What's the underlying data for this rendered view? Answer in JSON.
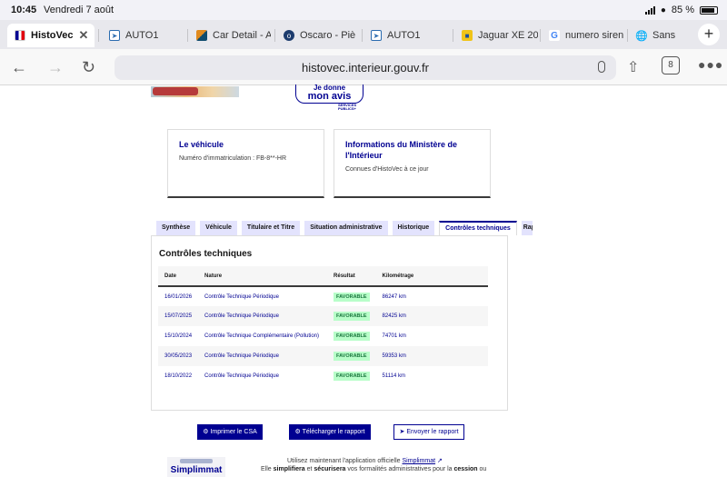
{
  "status_bar": {
    "time": "10:45",
    "date": "Vendredi 7 août",
    "battery": "85 %"
  },
  "tabs": [
    {
      "label": "HistoVec",
      "favicon": "french-flag",
      "active": true
    },
    {
      "label": "AUTO1",
      "favicon": "auto1"
    },
    {
      "label": "Car Detail - A",
      "favicon": "car-detail"
    },
    {
      "label": "Oscaro - Piè",
      "favicon": "oscaro"
    },
    {
      "label": "AUTO1",
      "favicon": "auto1"
    },
    {
      "label": "Jaguar XE 20",
      "favicon": "jaguar"
    },
    {
      "label": "numero siren",
      "favicon": "google"
    },
    {
      "label": "Sans",
      "favicon": "globe"
    }
  ],
  "toolbar": {
    "url": "histovec.interieur.gouv.fr",
    "tab_count": "8"
  },
  "banner": {
    "donne_l1": "Je donne",
    "donne_l2": "mon avis",
    "services_l1": "SERVICES",
    "services_l2": "PUBLICS+"
  },
  "cards": {
    "vehicle": {
      "title": "Le véhicule",
      "text": "Numéro d'immatriculation : FB-8**-HR"
    },
    "ministry": {
      "title": "Informations du Ministère de l'Intérieur",
      "text": "Connues d'HistoVec à ce jour"
    }
  },
  "page_tabs": [
    "Synthèse",
    "Véhicule",
    "Titulaire et Titre",
    "Situation administrative",
    "Historique",
    "Contrôles techniques",
    "Rap"
  ],
  "panel": {
    "title": "Contrôles techniques",
    "headers": [
      "Date",
      "Nature",
      "Résultat",
      "Kilométrage"
    ],
    "rows": [
      {
        "date": "16/01/2026",
        "nature": "Contrôle Technique Périodique",
        "result": "FAVORABLE",
        "km": "86247 km"
      },
      {
        "date": "15/07/2025",
        "nature": "Contrôle Technique Périodique",
        "result": "FAVORABLE",
        "km": "82425 km"
      },
      {
        "date": "15/10/2024",
        "nature": "Contrôle Technique Complémentaire (Pollution)",
        "result": "FAVORABLE",
        "km": "74701 km"
      },
      {
        "date": "30/05/2023",
        "nature": "Contrôle Technique Périodique",
        "result": "FAVORABLE",
        "km": "59353 km"
      },
      {
        "date": "18/10/2022",
        "nature": "Contrôle Technique Périodique",
        "result": "FAVORABLE",
        "km": "51114 km"
      }
    ]
  },
  "actions": {
    "print": "Imprimer le CSA",
    "download": "Télécharger le rapport",
    "send": "Envoyer le rapport"
  },
  "footer": {
    "logo": "Simplimmat",
    "line1_a": "Utilisez maintenant l'application officielle",
    "line1_link": "Simplimmat",
    "line2_a": "Elle",
    "line2_b": "simplifiera",
    "line2_c": "et",
    "line2_d": "sécurisera",
    "line2_e": "vos formalités administratives pour la",
    "line2_f": "cession",
    "line2_g": "ou"
  },
  "colors": {
    "primary": "#000091",
    "success_bg": "#b8fec9",
    "success_text": "#18753c"
  }
}
